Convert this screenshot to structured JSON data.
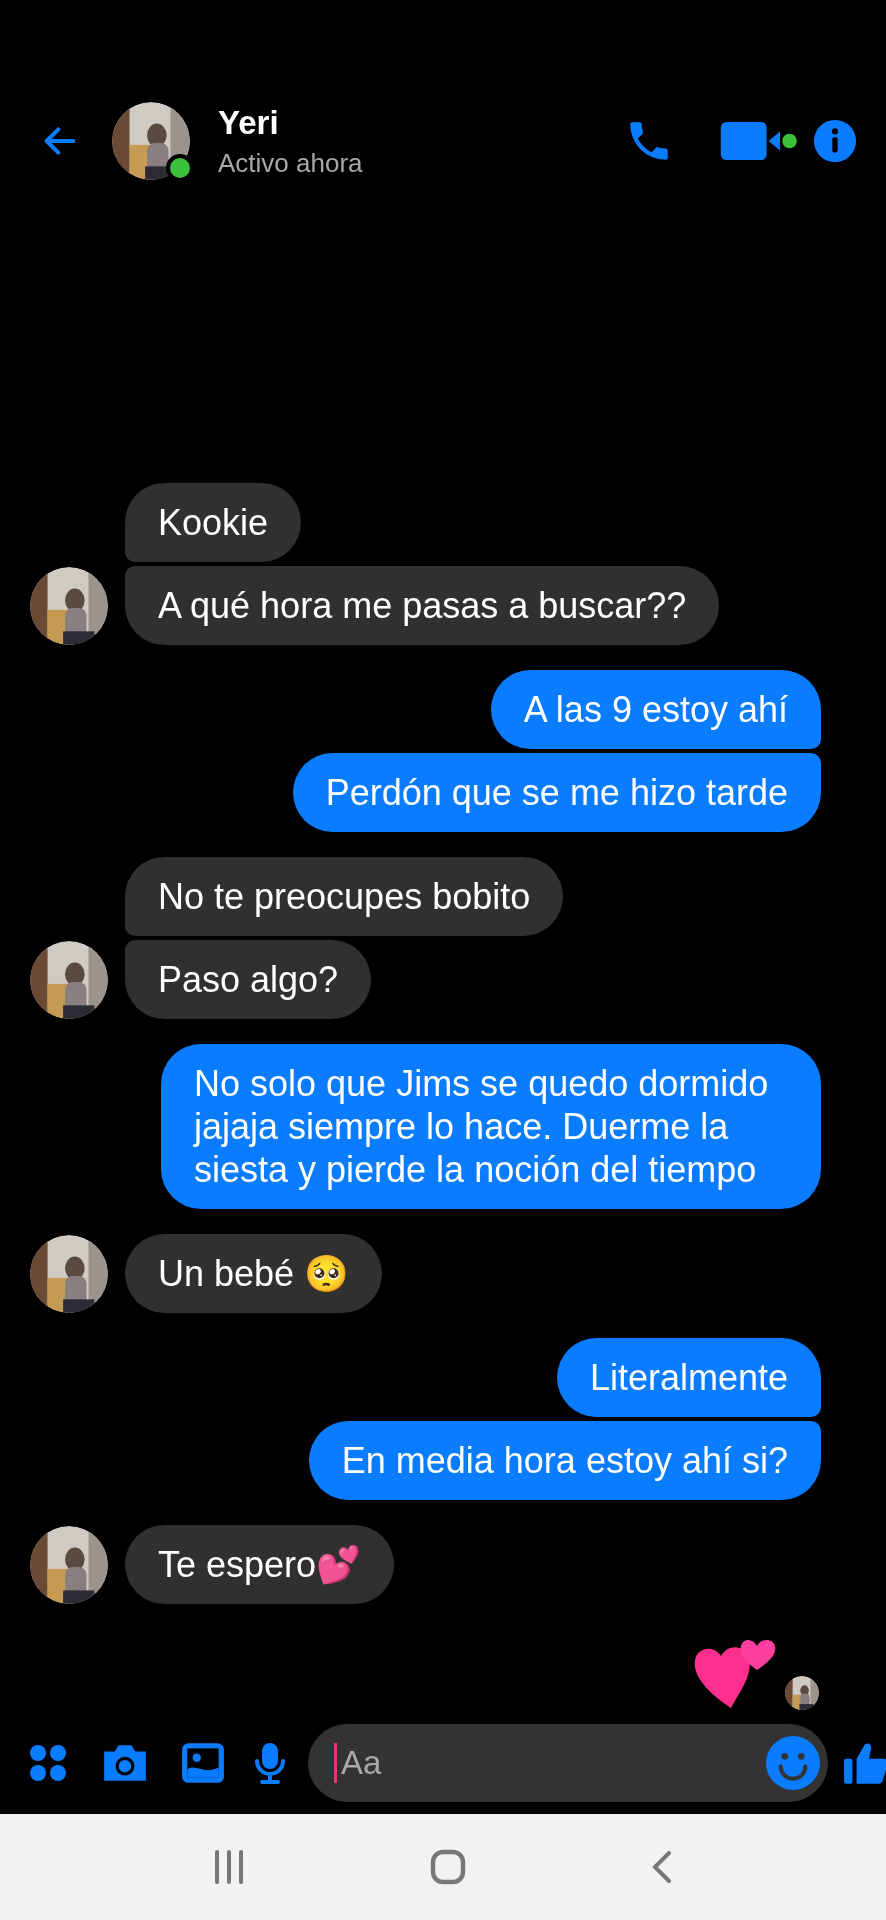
{
  "header": {
    "name": "Yeri",
    "status": "Activo ahora",
    "online": true,
    "video_active": true
  },
  "messages": [
    {
      "kind": "received",
      "text": "Kookie",
      "avatar": false
    },
    {
      "kind": "received",
      "text": "A qué hora me pasas a buscar??",
      "avatar": true
    },
    {
      "kind": "sent",
      "text": "A las 9 estoy ahí"
    },
    {
      "kind": "sent",
      "text": "Perdón que se me hizo tarde"
    },
    {
      "kind": "received",
      "text": "No te preocupes bobito",
      "avatar": false
    },
    {
      "kind": "received",
      "text": "Paso algo?",
      "avatar": true
    },
    {
      "kind": "sent",
      "text": "No solo que Jims se quedo dormido jajaja siempre lo hace. Duerme la siesta y pierde la noción del tiempo"
    },
    {
      "kind": "received",
      "text": "Un bebé 🥺",
      "avatar": true
    },
    {
      "kind": "sent",
      "text": "Literalmente"
    },
    {
      "kind": "sent",
      "text": "En media hora estoy ahí si?"
    },
    {
      "kind": "received",
      "text": "Te espero💕",
      "avatar": true
    }
  ],
  "composer": {
    "placeholder": "Aa"
  }
}
